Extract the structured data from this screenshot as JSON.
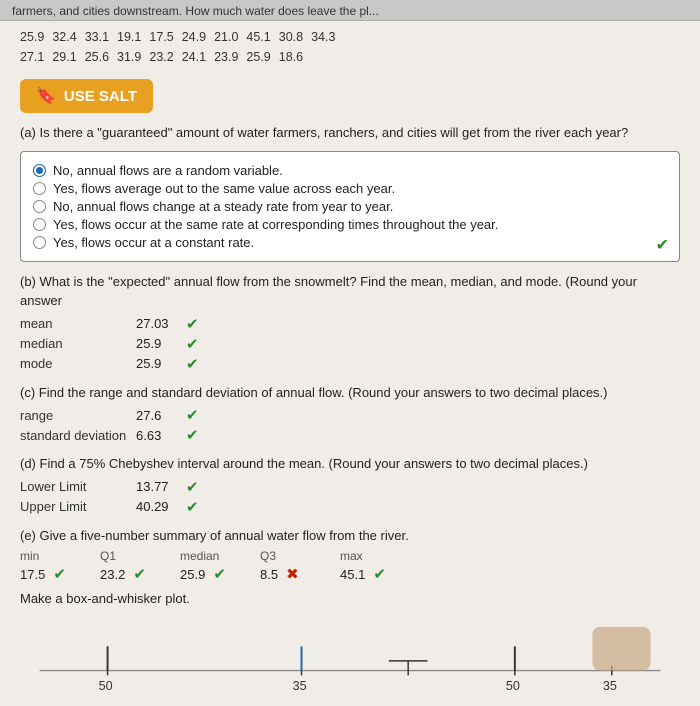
{
  "topbar": {
    "text": "farmers, and cities downstream. How much water does leave the pl..."
  },
  "top_numbers": [
    [
      "25.9",
      "32.4",
      "33.1",
      "19.1",
      "17.5",
      "24.9",
      "21.0",
      "45.1",
      "30.8",
      "34.3"
    ],
    [
      "27.1",
      "29.1",
      "25.6",
      "31.9",
      "23.2",
      "24.1",
      "23.9",
      "25.9",
      "18.6"
    ]
  ],
  "use_salt_label": "USE SALT",
  "part_a": {
    "question": "(a) Is there a \"guaranteed\" amount of water farmers, ranchers, and cities will get from the river each year?",
    "options": [
      {
        "label": "No, annual flows are a random variable.",
        "selected": true
      },
      {
        "label": "Yes, flows average out to the same value across each year.",
        "selected": false
      },
      {
        "label": "No, annual flows change at a steady rate from year to year.",
        "selected": false
      },
      {
        "label": "Yes, flows occur at the same rate at corresponding times throughout the year.",
        "selected": false
      },
      {
        "label": "Yes, flows occur at a constant rate.",
        "selected": false
      }
    ],
    "correct": true
  },
  "part_b": {
    "question": "(b) What is the \"expected\" annual flow from the snowmelt? Find the mean, median, and mode. (Round your answer",
    "fields": [
      {
        "label": "mean",
        "value": "27.03",
        "correct": true
      },
      {
        "label": "median",
        "value": "25.9",
        "correct": true
      },
      {
        "label": "mode",
        "value": "25.9",
        "correct": true
      }
    ]
  },
  "part_c": {
    "question": "(c) Find the range and standard deviation of annual flow. (Round your answers to two decimal places.)",
    "fields": [
      {
        "label": "range",
        "value": "27.6",
        "correct": true
      },
      {
        "label": "standard deviation",
        "value": "6.63",
        "correct": true
      }
    ]
  },
  "part_d": {
    "question": "(d) Find a 75% Chebyshev interval around the mean. (Round your answers to two decimal places.)",
    "fields": [
      {
        "label": "Lower Limit",
        "value": "13.77",
        "correct": true
      },
      {
        "label": "Upper Limit",
        "value": "40.29",
        "correct": true
      }
    ]
  },
  "part_e": {
    "question": "(e) Give a five-number summary of annual water flow from the river.",
    "headers": [
      "min",
      "Q1",
      "median",
      "Q3",
      "max"
    ],
    "values": [
      "17.5",
      "23.2",
      "25.9",
      "8.5",
      "45.1"
    ],
    "correct": [
      true,
      true,
      true,
      false,
      true
    ]
  },
  "make_plot_label": "Make a box-and-whisker plot.",
  "box_plot": {
    "labels": [
      "50",
      "35",
      "50",
      "35"
    ],
    "axis_labels": [
      "50",
      "35",
      "50"
    ],
    "note": ""
  }
}
